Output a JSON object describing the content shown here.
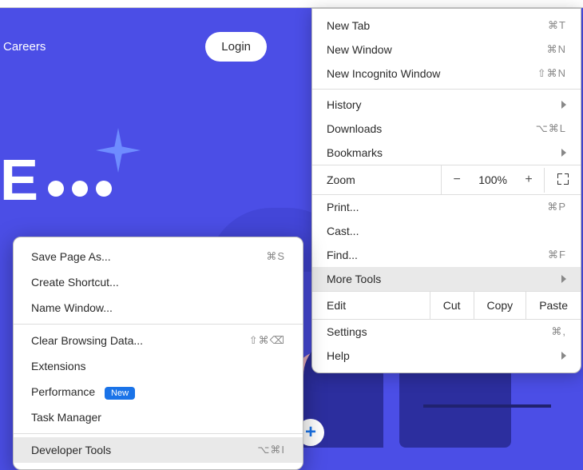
{
  "header": {
    "nav_link": "Careers",
    "login_label": "Login"
  },
  "hero_fragment": "E...",
  "main_menu": {
    "new_tab": {
      "label": "New Tab",
      "shortcut": "⌘T"
    },
    "new_window": {
      "label": "New Window",
      "shortcut": "⌘N"
    },
    "new_incognito": {
      "label": "New Incognito Window",
      "shortcut": "⇧⌘N"
    },
    "history": {
      "label": "History"
    },
    "downloads": {
      "label": "Downloads",
      "shortcut": "⌥⌘L"
    },
    "bookmarks": {
      "label": "Bookmarks"
    },
    "zoom": {
      "label": "Zoom",
      "value": "100%",
      "minus": "−",
      "plus": "+"
    },
    "print": {
      "label": "Print...",
      "shortcut": "⌘P"
    },
    "cast": {
      "label": "Cast..."
    },
    "find": {
      "label": "Find...",
      "shortcut": "⌘F"
    },
    "more_tools": {
      "label": "More Tools"
    },
    "edit": {
      "label": "Edit",
      "cut": "Cut",
      "copy": "Copy",
      "paste": "Paste"
    },
    "settings": {
      "label": "Settings",
      "shortcut": "⌘,"
    },
    "help": {
      "label": "Help"
    }
  },
  "sub_menu": {
    "save_page": {
      "label": "Save Page As...",
      "shortcut": "⌘S"
    },
    "create_shortcut": {
      "label": "Create Shortcut..."
    },
    "name_window": {
      "label": "Name Window..."
    },
    "clear_browsing": {
      "label": "Clear Browsing Data...",
      "shortcut": "⇧⌘⌫"
    },
    "extensions": {
      "label": "Extensions"
    },
    "performance": {
      "label": "Performance",
      "badge": "New"
    },
    "task_manager": {
      "label": "Task Manager"
    },
    "developer_tools": {
      "label": "Developer Tools",
      "shortcut": "⌥⌘I"
    }
  }
}
